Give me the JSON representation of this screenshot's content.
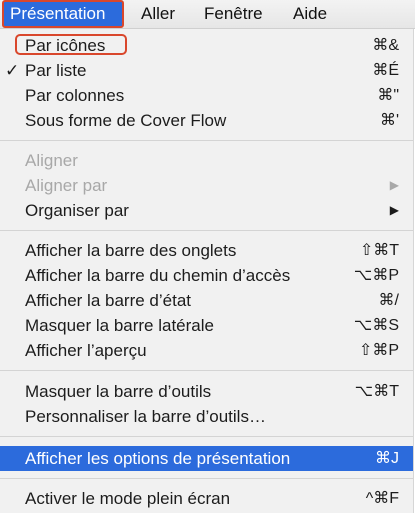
{
  "menubar": {
    "items": [
      {
        "label": "Présentation"
      },
      {
        "label": "Aller"
      },
      {
        "label": "Fenêtre"
      },
      {
        "label": "Aide"
      }
    ]
  },
  "menu": {
    "view_as_icons": {
      "label": "Par icônes",
      "shortcut": "⌘&"
    },
    "view_as_list": {
      "label": "Par liste",
      "shortcut": "⌘É",
      "check": "✓"
    },
    "view_as_columns": {
      "label": "Par colonnes",
      "shortcut": "⌘\""
    },
    "view_cover_flow": {
      "label": "Sous forme de Cover Flow",
      "shortcut": "⌘'"
    },
    "align": {
      "label": "Aligner"
    },
    "align_by": {
      "label": "Aligner par",
      "arrow": "▶"
    },
    "arrange_by": {
      "label": "Organiser par",
      "arrow": "▶"
    },
    "show_tab_bar": {
      "label": "Afficher la barre des onglets",
      "shortcut": "⇧⌘T"
    },
    "show_path_bar": {
      "label": "Afficher la barre du chemin d’accès",
      "shortcut": "⌥⌘P"
    },
    "show_status_bar": {
      "label": "Afficher la barre d’état",
      "shortcut": "⌘/"
    },
    "hide_sidebar": {
      "label": "Masquer la barre latérale",
      "shortcut": "⌥⌘S"
    },
    "show_preview": {
      "label": "Afficher l’aperçu",
      "shortcut": "⇧⌘P"
    },
    "hide_toolbar": {
      "label": "Masquer la barre d’outils",
      "shortcut": "⌥⌘T"
    },
    "customize_toolbar": {
      "label": "Personnaliser la barre d’outils…"
    },
    "show_view_options": {
      "label": "Afficher les options de présentation",
      "shortcut": "⌘J"
    },
    "fullscreen": {
      "label": "Activer le mode plein écran",
      "shortcut": "^⌘F"
    }
  },
  "colors": {
    "accent": "#2c6bdc",
    "annotation_outline": "#d9472c",
    "disabled_text": "#a8a8a8"
  }
}
